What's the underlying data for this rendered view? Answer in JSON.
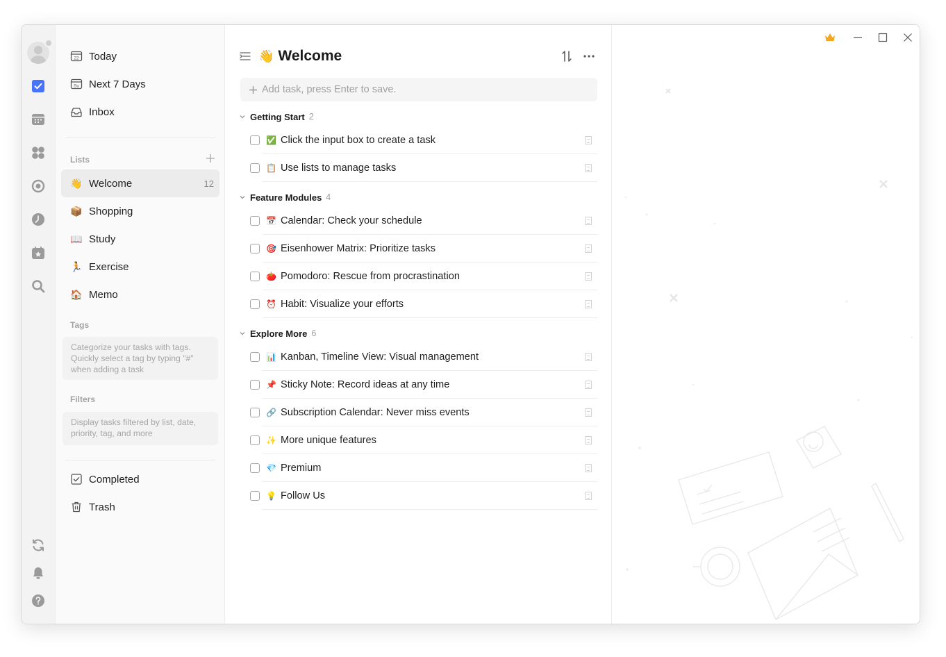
{
  "app": {
    "accent": "#4772fa",
    "premium_color": "#f5a623"
  },
  "rail": {
    "icons": [
      "avatar",
      "check-square-icon",
      "calendar-icon",
      "matrix-icon",
      "pomodoro-icon",
      "clock-icon",
      "habit-icon",
      "search-icon",
      "sync-icon",
      "bell-icon",
      "help-icon"
    ]
  },
  "sidebar": {
    "smart": [
      {
        "label": "Today",
        "icon": "calendar-today-icon",
        "glyph": "22"
      },
      {
        "label": "Next 7 Days",
        "icon": "calendar-week-icon",
        "glyph": "Su"
      },
      {
        "label": "Inbox",
        "icon": "inbox-icon"
      }
    ],
    "lists_label": "Lists",
    "lists": [
      {
        "label": "Welcome",
        "emoji": "👋",
        "count": "12"
      },
      {
        "label": "Shopping",
        "emoji": "📦"
      },
      {
        "label": "Study",
        "emoji": "📖"
      },
      {
        "label": "Exercise",
        "emoji": "🏃"
      },
      {
        "label": "Memo",
        "emoji": "🏠"
      }
    ],
    "tags_label": "Tags",
    "tags_hint": "Categorize your tasks with tags. Quickly select a tag by typing \"#\" when adding a task",
    "filters_label": "Filters",
    "filters_hint": "Display tasks filtered by list, date, priority, tag, and more",
    "bottom": [
      {
        "label": "Completed",
        "icon": "completed-icon"
      },
      {
        "label": "Trash",
        "icon": "trash-icon"
      }
    ]
  },
  "main": {
    "title_emoji": "👋",
    "title": "Welcome",
    "add_placeholder": "Add task, press Enter to save.",
    "groups": [
      {
        "name": "Getting Start",
        "count": "2",
        "tasks": [
          {
            "emoji": "✅",
            "label": "Click the input box to create a task"
          },
          {
            "emoji": "📋",
            "label": "Use lists to manage tasks"
          }
        ]
      },
      {
        "name": "Feature Modules",
        "count": "4",
        "tasks": [
          {
            "emoji": "📅",
            "label": "Calendar: Check your schedule"
          },
          {
            "emoji": "🎯",
            "label": "Eisenhower Matrix: Prioritize tasks"
          },
          {
            "emoji": "🍅",
            "label": "Pomodoro: Rescue from procrastination"
          },
          {
            "emoji": "⏰",
            "label": "Habit: Visualize your efforts"
          }
        ]
      },
      {
        "name": "Explore More",
        "count": "6",
        "tasks": [
          {
            "emoji": "📊",
            "label": "Kanban, Timeline View: Visual management"
          },
          {
            "emoji": "📌",
            "label": "Sticky Note: Record ideas at any time"
          },
          {
            "emoji": "🔗",
            "label": "Subscription Calendar: Never miss events"
          },
          {
            "emoji": "✨",
            "label": "More unique features"
          },
          {
            "emoji": "💎",
            "label": "Premium"
          },
          {
            "emoji": "💡",
            "label": "Follow Us"
          }
        ]
      }
    ]
  }
}
